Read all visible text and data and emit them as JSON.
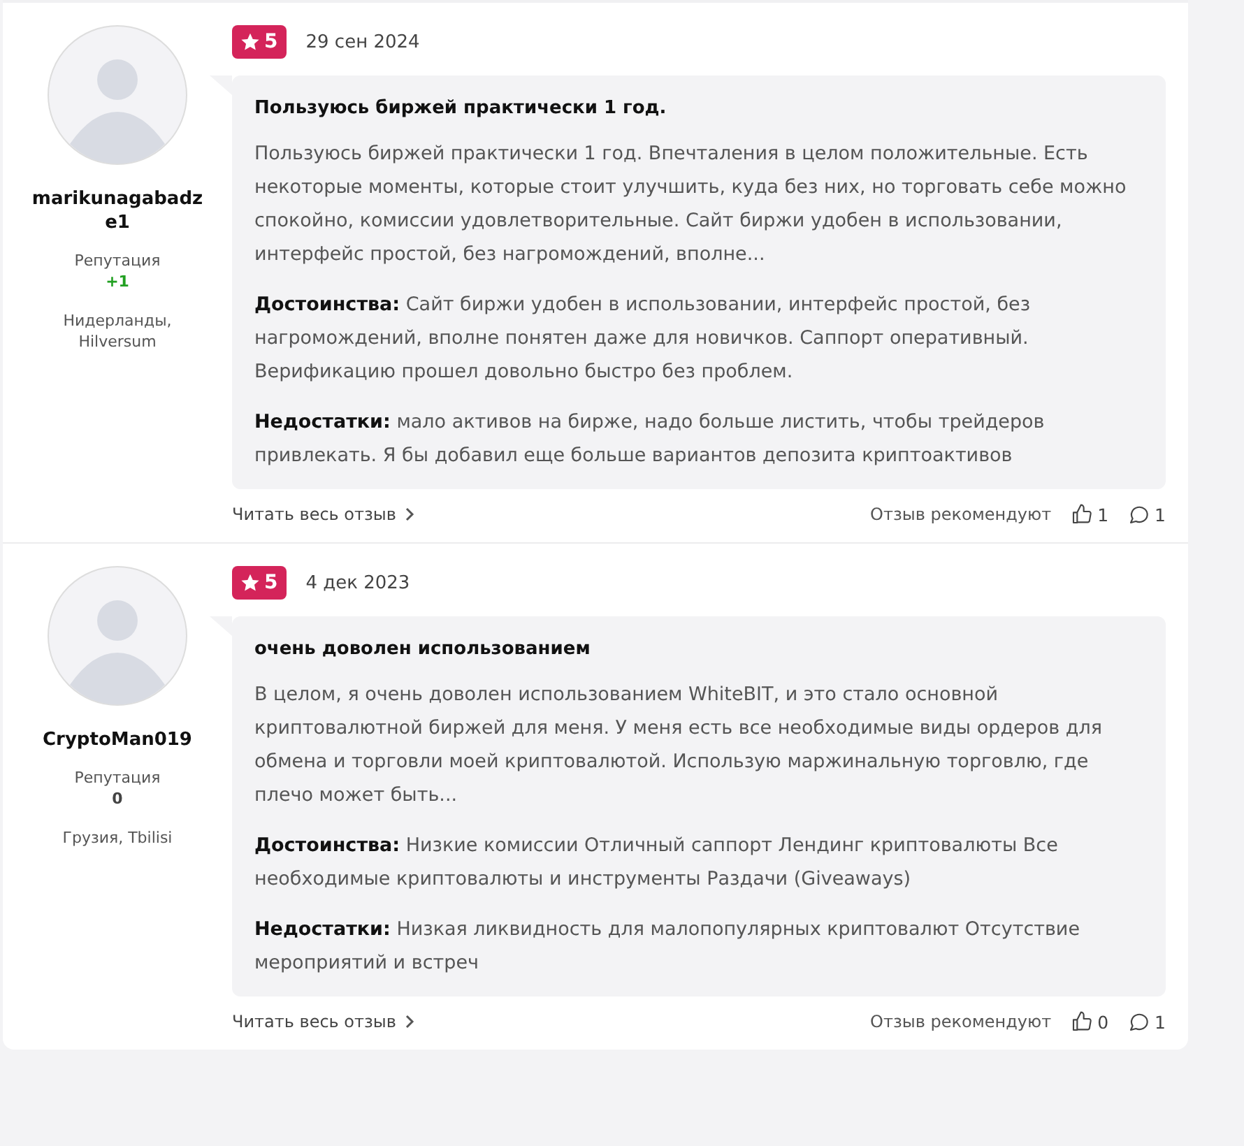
{
  "reviews": [
    {
      "author": {
        "name": "marikunagabadze1",
        "reputation_label": "Репутация",
        "reputation": {
          "value": "+1",
          "color": "#22a022"
        },
        "location": "Нидерланды, Hilversum"
      },
      "rating": "5",
      "date": "29 сен 2024",
      "title": "Пользуюсь биржей практически 1 год.",
      "text": "Пользуюсь биржей практически 1 год. Впечталения в целом положительные. Есть некоторые моменты, которые стоит улучшить, куда без них, но торговать себе можно спокойно, комиссии удовлетворительные. Сайт биржи удобен в использовании, интерфейс простой, без нагромождений, вполне...",
      "pros": "**Достоинства:** Сайт биржи удобен в использовании, интерфейс простой, без нагромождений, вполне понятен даже для новичков. Саппорт оперативный. Верификацию прошел довольно быстро без проблем.",
      "cons": "**Недостатки:** мало активов на бирже, надо больше листить, чтобы трейдеров привлекать. Я бы добавил еще больше вариантов депозита криптоактивов",
      "read_more": "Читать весь отзыв",
      "recommend_label": "Отзыв рекомендуют",
      "likes": "1",
      "comments": "1"
    },
    {
      "author": {
        "name": "CryptoMan019",
        "reputation_label": "Репутация",
        "reputation": {
          "value": "0",
          "color": "#444444"
        },
        "location": "Грузия, Tbilisi"
      },
      "rating": "5",
      "date": "4 дек 2023",
      "title": "очень доволен использованием",
      "text": "В целом, я очень доволен использованием WhiteBIT, и это стало основной криптовалютной биржей для меня. У меня есть все необходимые виды ордеров для обмена и торговли моей криптовалютой. Использую маржинальную торговлю, где плечо может быть...",
      "pros": "**Достоинства:** Низкие комиссии Отличный саппорт Лендинг криптовалюты Все необходимые криптовалюты и инструменты Раздачи (Giveaways)",
      "cons": "**Недостатки:** Низкая ликвидность для малопопулярных криптовалют Отсутствие мероприятий и встреч",
      "read_more": "Читать весь отзыв",
      "recommend_label": "Отзыв рекомендуют",
      "likes": "0",
      "comments": "1"
    }
  ]
}
